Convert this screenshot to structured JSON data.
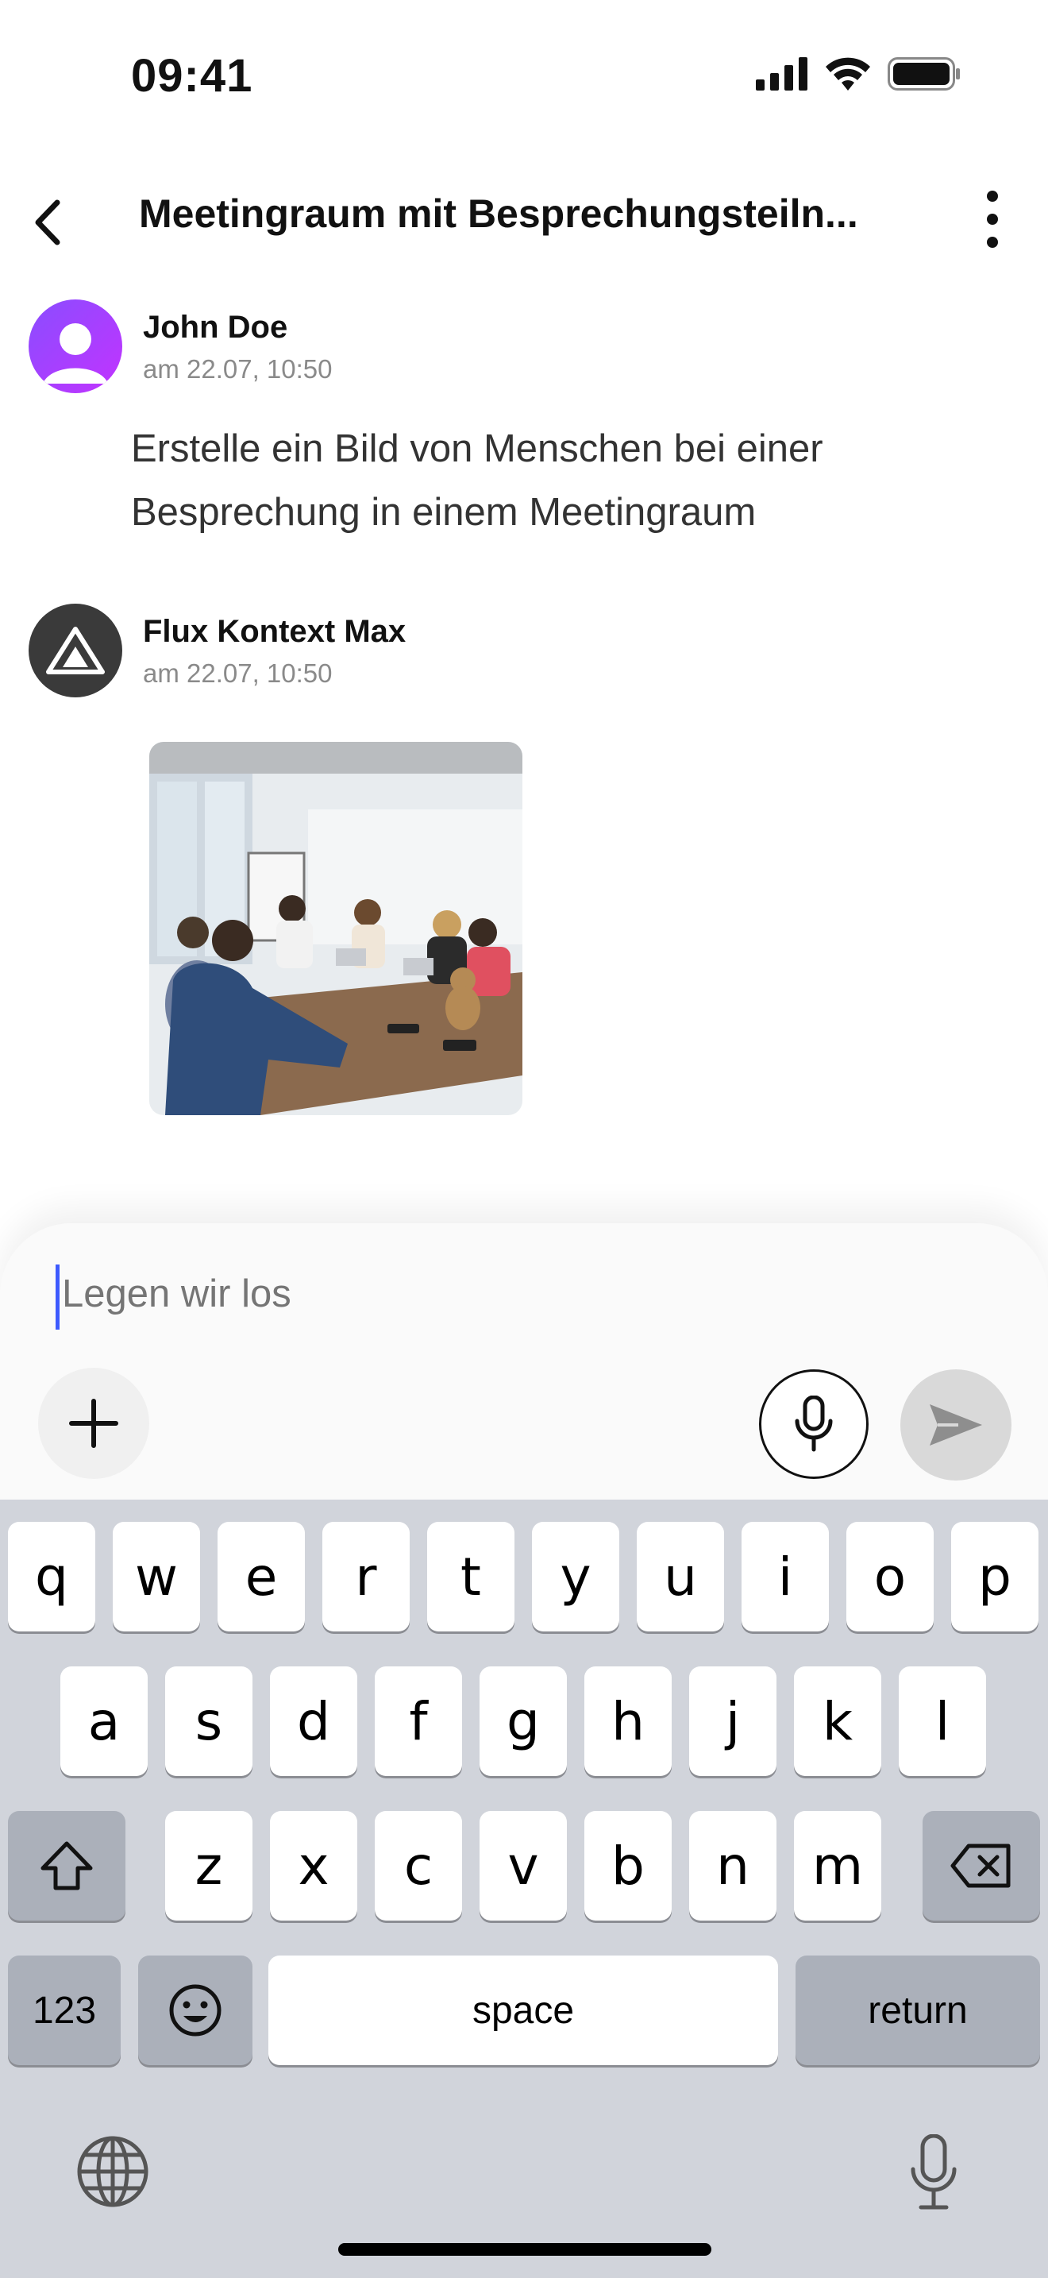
{
  "status_bar": {
    "time": "09:41",
    "icons": [
      "signal-icon",
      "wifi-icon",
      "battery-icon"
    ]
  },
  "header": {
    "title": "Meetingraum mit Besprechungsteiln..."
  },
  "messages": [
    {
      "author": "John Doe",
      "time": "am 22.07, 10:50",
      "text": "Erstelle ein Bild von Menschen bei einer Besprechung in einem Meetingraum"
    },
    {
      "author": "Flux Kontext Max",
      "time": "am 22.07, 10:50"
    }
  ],
  "composer": {
    "placeholder": "Legen wir los"
  },
  "keyboard": {
    "row1": [
      "q",
      "w",
      "e",
      "r",
      "t",
      "y",
      "u",
      "i",
      "o",
      "p"
    ],
    "row2": [
      "a",
      "s",
      "d",
      "f",
      "g",
      "h",
      "j",
      "k",
      "l"
    ],
    "row3": [
      "z",
      "x",
      "c",
      "v",
      "b",
      "n",
      "m"
    ],
    "numbers": "123",
    "space": "space",
    "return": "return"
  },
  "colors": {
    "accent": "#3d5afe",
    "keyboard_bg": "#d1d4db",
    "send_disabled": "#d9d9d9"
  }
}
